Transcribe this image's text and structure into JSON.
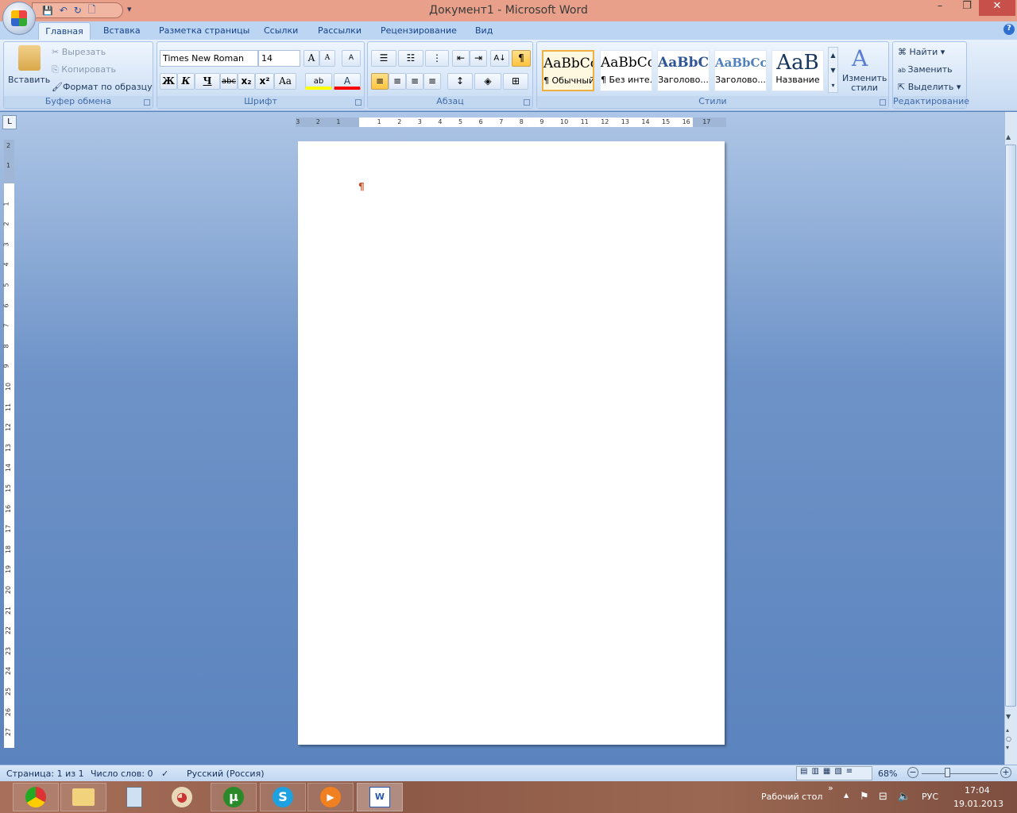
{
  "window": {
    "title": "Документ1 - Microsoft Word",
    "minimize": "–",
    "restore": "❐",
    "close": "✕"
  },
  "qat": {
    "save": "💾",
    "undo": "↶",
    "redo": "↻",
    "new": "🗋",
    "customize": "▾"
  },
  "tabs": [
    "Главная",
    "Вставка",
    "Разметка страницы",
    "Ссылки",
    "Рассылки",
    "Рецензирование",
    "Вид"
  ],
  "help": "?",
  "clipboard": {
    "paste": "Вставить",
    "cut": "Вырезать",
    "copy": "Копировать",
    "format_painter": "Формат по образцу",
    "group": "Буфер обмена"
  },
  "font": {
    "name": "Times New Roman",
    "size": "14",
    "grow": "A",
    "shrink": "A",
    "clear": "A",
    "bold": "Ж",
    "italic": "К",
    "underline": "Ч",
    "strike": "abc",
    "subscript": "x₂",
    "superscript": "x²",
    "case": "Aa",
    "highlight": "ab",
    "color": "A",
    "group": "Шрифт",
    "highlight_color": "#ffff00",
    "font_color": "#ff0000"
  },
  "paragraph": {
    "group": "Абзац",
    "show_marks": "¶",
    "sort": "A↓"
  },
  "styles": {
    "items": [
      {
        "preview": "AaBbCcI",
        "label": "¶ Обычный",
        "active": true
      },
      {
        "preview": "AaBbCcI",
        "label": "¶ Без инте..."
      },
      {
        "preview": "AaBbCc",
        "label": "Заголово..."
      },
      {
        "preview": "AaBbCc",
        "label": "Заголово..."
      },
      {
        "preview": "AaB",
        "label": "Название"
      }
    ],
    "change": "Изменить стили",
    "group": "Стили"
  },
  "editing": {
    "find": "Найти",
    "replace": "Заменить",
    "select": "Выделить",
    "group": "Редактирование"
  },
  "ruler": {
    "h_left": [
      "3",
      "2",
      "1"
    ],
    "h_right": [
      "1",
      "2",
      "3",
      "4",
      "5",
      "6",
      "7",
      "8",
      "9",
      "10",
      "11",
      "12",
      "13",
      "14",
      "15",
      "16",
      "17"
    ],
    "v_top": [
      "2",
      "1"
    ],
    "v_main": [
      "1",
      "2",
      "3",
      "4",
      "5",
      "6",
      "7",
      "8",
      "9",
      "10",
      "11",
      "12",
      "13",
      "14",
      "15",
      "16",
      "17",
      "18",
      "19",
      "20",
      "21",
      "22",
      "23",
      "24",
      "25",
      "26",
      "27"
    ]
  },
  "document": {
    "pilcrow": "¶"
  },
  "status": {
    "page": "Страница: 1 из 1",
    "words": "Число слов: 0",
    "language": "Русский (Россия)",
    "zoom": "68%",
    "zoom_percent": 68
  },
  "taskbar": {
    "apps": [
      "Chrome",
      "Проводник",
      "Калькулятор",
      "Paint",
      "uTorrent",
      "Skype",
      "Media Player",
      "Microsoft Word"
    ],
    "desktop": "Рабочий стол",
    "lang": "РУС",
    "time": "17:04",
    "date": "19.01.2013"
  }
}
